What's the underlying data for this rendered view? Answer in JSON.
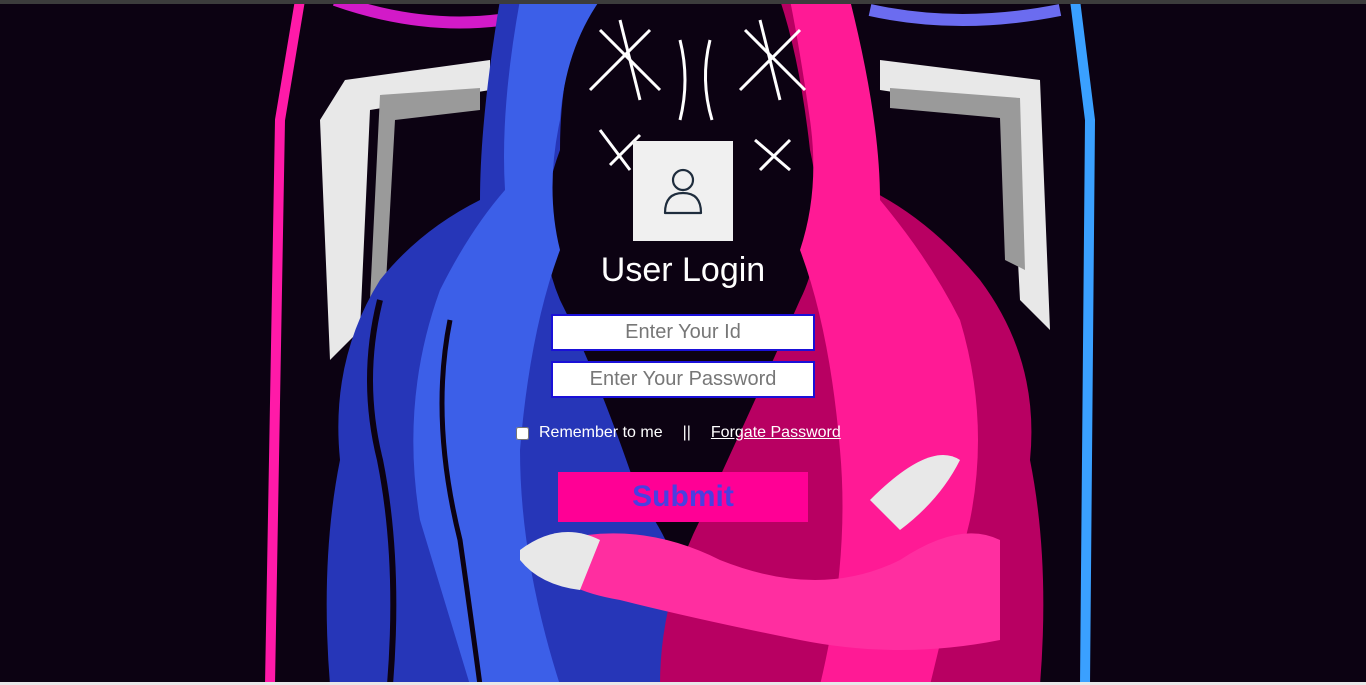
{
  "login": {
    "title": "User Login",
    "id_placeholder": "Enter Your Id",
    "password_placeholder": "Enter Your Password",
    "remember_label": "Remember to me",
    "separator": "||",
    "forgot_label": "Forgate Password",
    "submit_label": "Submit"
  },
  "icons": {
    "avatar": "user-icon"
  },
  "colors": {
    "background": "#0c0212",
    "accent_pink": "#ff0095",
    "accent_blue": "#3a4fd8",
    "input_border": "#1a10d8",
    "submit_text": "#4a3fe0"
  }
}
